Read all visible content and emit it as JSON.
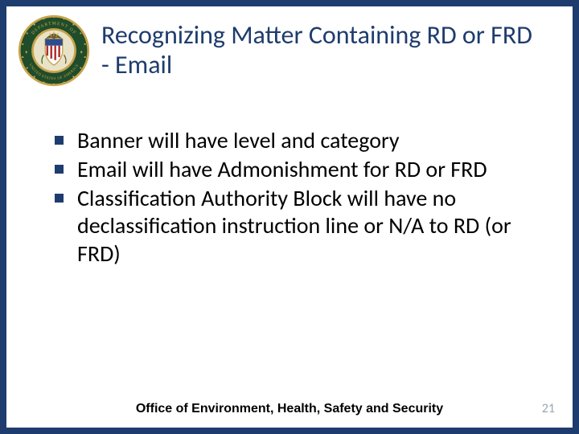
{
  "title": "Recognizing Matter Containing RD or FRD - Email",
  "bullets": [
    "Banner will have level and category",
    "Email will have Admonishment for RD or FRD",
    "Classification Authority Block will have no declassification instruction line or N/A to RD (or FRD)"
  ],
  "footer": "Office of Environment, Health, Safety and Security",
  "page_number": "21",
  "seal": {
    "outer_text_top": "DEPARTMENT OF",
    "outer_text_bottom": "UNITED STATES OF AMERICA",
    "colors": {
      "ring": "#1f4d2b",
      "gold": "#c9a34a",
      "shield_blue": "#2a4d8f",
      "shield_red": "#b03030"
    }
  }
}
